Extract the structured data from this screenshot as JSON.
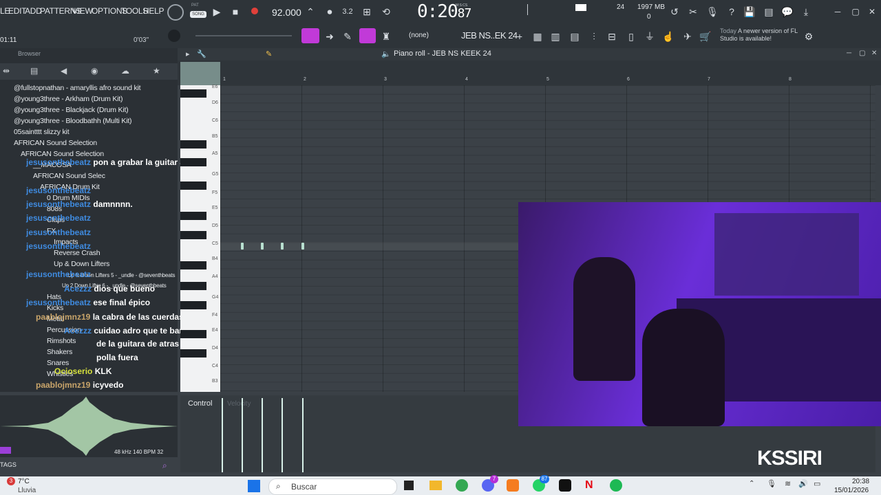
{
  "menu": {
    "items": [
      "LE",
      "EDIT",
      "ADD",
      "PATTERNS",
      "VIEW",
      "OPTIONS",
      "TOOLS",
      "HELP"
    ],
    "pat_label": "PAT",
    "song_label": "SONG",
    "tempo": "92.000",
    "time": "0:20",
    "time_frac": "87",
    "time_unit": "M:S:CS",
    "cpu": "24",
    "memory": "1997 MB",
    "poly": "0"
  },
  "row2": {
    "left_time": "01:11",
    "vol_time": "0'03\"",
    "snap": "(none)",
    "pattern": "JEB NS..EK 24",
    "news_today": "Today",
    "news_text": "A newer version of FL Studio is available!"
  },
  "browser": {
    "title": "Browser",
    "items": [
      "@fullstopnathan - amaryllis afro sound kit",
      "@young3three - Arkham (Drum Kit)",
      "@young3three - Blackjack (Drum Kit)",
      "@young3three - Bloodbathh (Multi Kit)",
      "05saintttt slizzy kit",
      "AFRICAN Sound Selection",
      "AFRICAN Sound Selection",
      "__MACOSA",
      "AFRICAN Sound Selec",
      "AFRICAN Drum Kit",
      "0 Drum MIDIs",
      "808s",
      "Claps",
      "FX",
      "Impacts",
      "Reverse Crash",
      "Up & Down Lifters",
      "Up & Down Lifters 5 - _undle - @seventhbeats",
      "Up 2 Down Lifter 6 - _undle - @seventhbeats",
      "Hats",
      "Kicks",
      "Metal",
      "Percussion",
      "Rimshots",
      "Shakers",
      "Snares",
      "Whistles"
    ],
    "sample_info": "48 kHz 140 BPM 32",
    "tags_label": "TAGS"
  },
  "chat": [
    {
      "user": "jesusonthebeatz",
      "msg": "pon a grabar la guitar ad"
    },
    {
      "user": "jesusonthebeatz",
      "msg": ""
    },
    {
      "user": "jesusonthebeatz",
      "msg": "damnnnn."
    },
    {
      "user": "jesusonthebeatz",
      "msg": ""
    },
    {
      "user": "jesusonthebeatz",
      "msg": ""
    },
    {
      "user": "jesusonthebeatz",
      "msg": ""
    },
    {
      "user": "jesusonthebeatz",
      "msg": ""
    },
    {
      "user": "Acezzz",
      "msg": "dios que bueno"
    },
    {
      "user": "jesusonthebeatz",
      "msg": "ese final épico"
    },
    {
      "user": "paablojmnz19",
      "msg": "la cabra de las cuerdas"
    },
    {
      "user": "Acezzz",
      "msg": "cuidao adro que te banean que el"
    },
    {
      "user": "",
      "msg": "de la guitara de atras va con la"
    },
    {
      "user": "",
      "msg": "polla fuera"
    },
    {
      "user": "Ocioserio",
      "msg": "KLK"
    },
    {
      "user": "paablojmnz19",
      "msg": "icyvedo"
    }
  ],
  "piano_roll": {
    "title": "Piano roll - JEB NS KEEK 24",
    "bars": [
      "1",
      "2",
      "3",
      "4",
      "5",
      "6",
      "7",
      "8"
    ],
    "keys": [
      "E6",
      "D6",
      "C6",
      "B5",
      "A5",
      "G5",
      "F5",
      "E5",
      "D5",
      "C5",
      "B4",
      "A4",
      "G4",
      "F4",
      "E4",
      "D4",
      "C4",
      "B3"
    ],
    "control_label": "Control",
    "control_sub": "Velocity"
  },
  "watermark": "KSSIRI",
  "taskbar": {
    "temp": "7°C",
    "weather": "Lluvia",
    "search_placeholder": "Buscar",
    "badge_notif": "3",
    "badge_discord": "7",
    "badge_whatsapp": "87",
    "time": "20:38",
    "date": "15/01/2026"
  }
}
